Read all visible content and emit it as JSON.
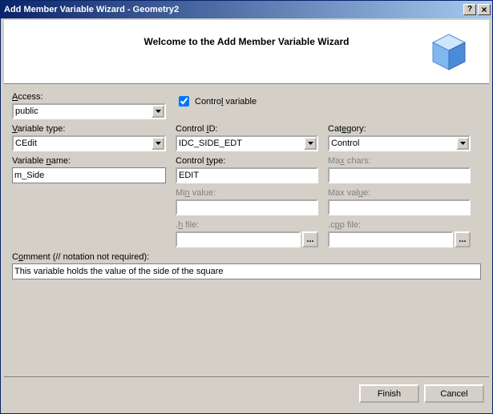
{
  "titlebar": "Add Member Variable Wizard - Geometry2",
  "header_title": "Welcome to the Add Member Variable Wizard",
  "labels": {
    "access": "Access:",
    "control_variable": "Control variable",
    "variable_type": "Variable type:",
    "control_id": "Control ID:",
    "category": "Category:",
    "variable_name": "Variable name:",
    "control_type": "Control type:",
    "max_chars": "Max chars:",
    "min_value": "Min value:",
    "max_value": "Max value:",
    "h_file": ".h file:",
    "cpp_file": ".cpp file:",
    "comment": "Comment (// notation not required):"
  },
  "values": {
    "access": "public",
    "control_variable_checked": true,
    "variable_type": "CEdit",
    "control_id": "IDC_SIDE_EDT",
    "category": "Control",
    "variable_name": "m_Side",
    "control_type": "EDIT",
    "max_chars": "",
    "min_value": "",
    "max_value": "",
    "h_file": "",
    "cpp_file": "",
    "comment": "This variable holds the value of the side of the square"
  },
  "buttons": {
    "finish": "Finish",
    "cancel": "Cancel",
    "help": "?",
    "close": "×",
    "browse": "..."
  }
}
